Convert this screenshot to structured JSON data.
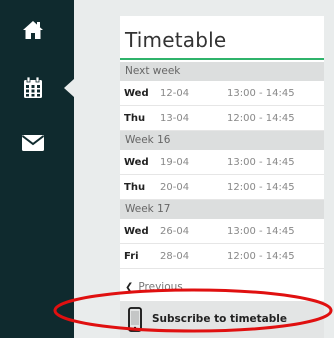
{
  "sidebar": {
    "items": [
      {
        "icon": "home-icon"
      },
      {
        "icon": "calendar-icon"
      },
      {
        "icon": "envelope-icon"
      }
    ],
    "background": "#0f2a2e"
  },
  "timetable": {
    "title": "Timetable",
    "accent": "#2fb36b",
    "groups": [
      {
        "label": "Next week",
        "rows": [
          {
            "day": "Wed",
            "date": "12-04",
            "time": "13:00 - 14:45"
          },
          {
            "day": "Thu",
            "date": "13-04",
            "time": "12:00 - 14:45"
          }
        ]
      },
      {
        "label": "Week 16",
        "rows": [
          {
            "day": "Wed",
            "date": "19-04",
            "time": "13:00 - 14:45"
          },
          {
            "day": "Thu",
            "date": "20-04",
            "time": "12:00 - 14:45"
          }
        ]
      },
      {
        "label": "Week 17",
        "rows": [
          {
            "day": "Wed",
            "date": "26-04",
            "time": "13:00 - 14:45"
          },
          {
            "day": "Fri",
            "date": "28-04",
            "time": "12:00 - 14:45"
          }
        ]
      }
    ],
    "previous_label": "Previous",
    "subscribe_label": "Subscribe to timetable"
  },
  "annotation": {
    "shape": "oval",
    "color": "#e01010"
  }
}
